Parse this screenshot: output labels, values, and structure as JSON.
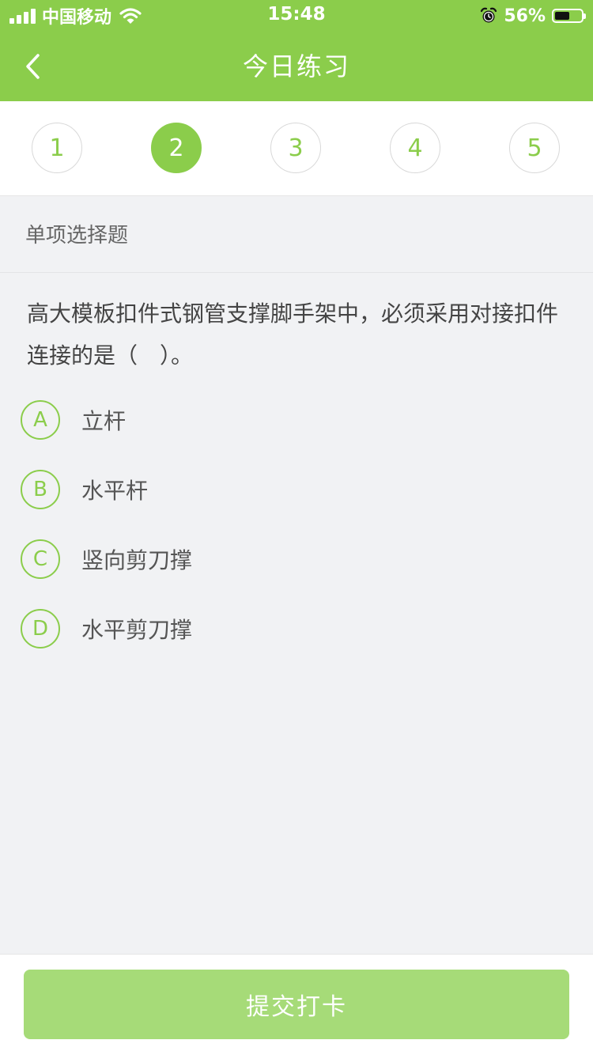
{
  "status_bar": {
    "carrier": "中国移动",
    "time": "15:48",
    "battery_percent": "56%",
    "battery_level": 0.56,
    "icons": [
      "signal-icon",
      "wifi-icon",
      "alarm-icon",
      "battery-icon"
    ]
  },
  "nav": {
    "title": "今日练习",
    "back_icon": "chevron-left-icon"
  },
  "tabs": [
    {
      "label": "1",
      "active": false
    },
    {
      "label": "2",
      "active": true
    },
    {
      "label": "3",
      "active": false
    },
    {
      "label": "4",
      "active": false
    },
    {
      "label": "5",
      "active": false
    }
  ],
  "question": {
    "type": "单项选择题",
    "text": "高大模板扣件式钢管支撑脚手架中，必须采用对接扣件连接的是（　）。",
    "options": [
      {
        "letter": "A",
        "text": "立杆"
      },
      {
        "letter": "B",
        "text": "水平杆"
      },
      {
        "letter": "C",
        "text": "竖向剪刀撑"
      },
      {
        "letter": "D",
        "text": "水平剪刀撑"
      }
    ]
  },
  "footer": {
    "submit_label": "提交打卡"
  },
  "colors": {
    "brand_green": "#8bcd4b",
    "submit_button": "#a6db78",
    "background": "#f1f2f4"
  }
}
